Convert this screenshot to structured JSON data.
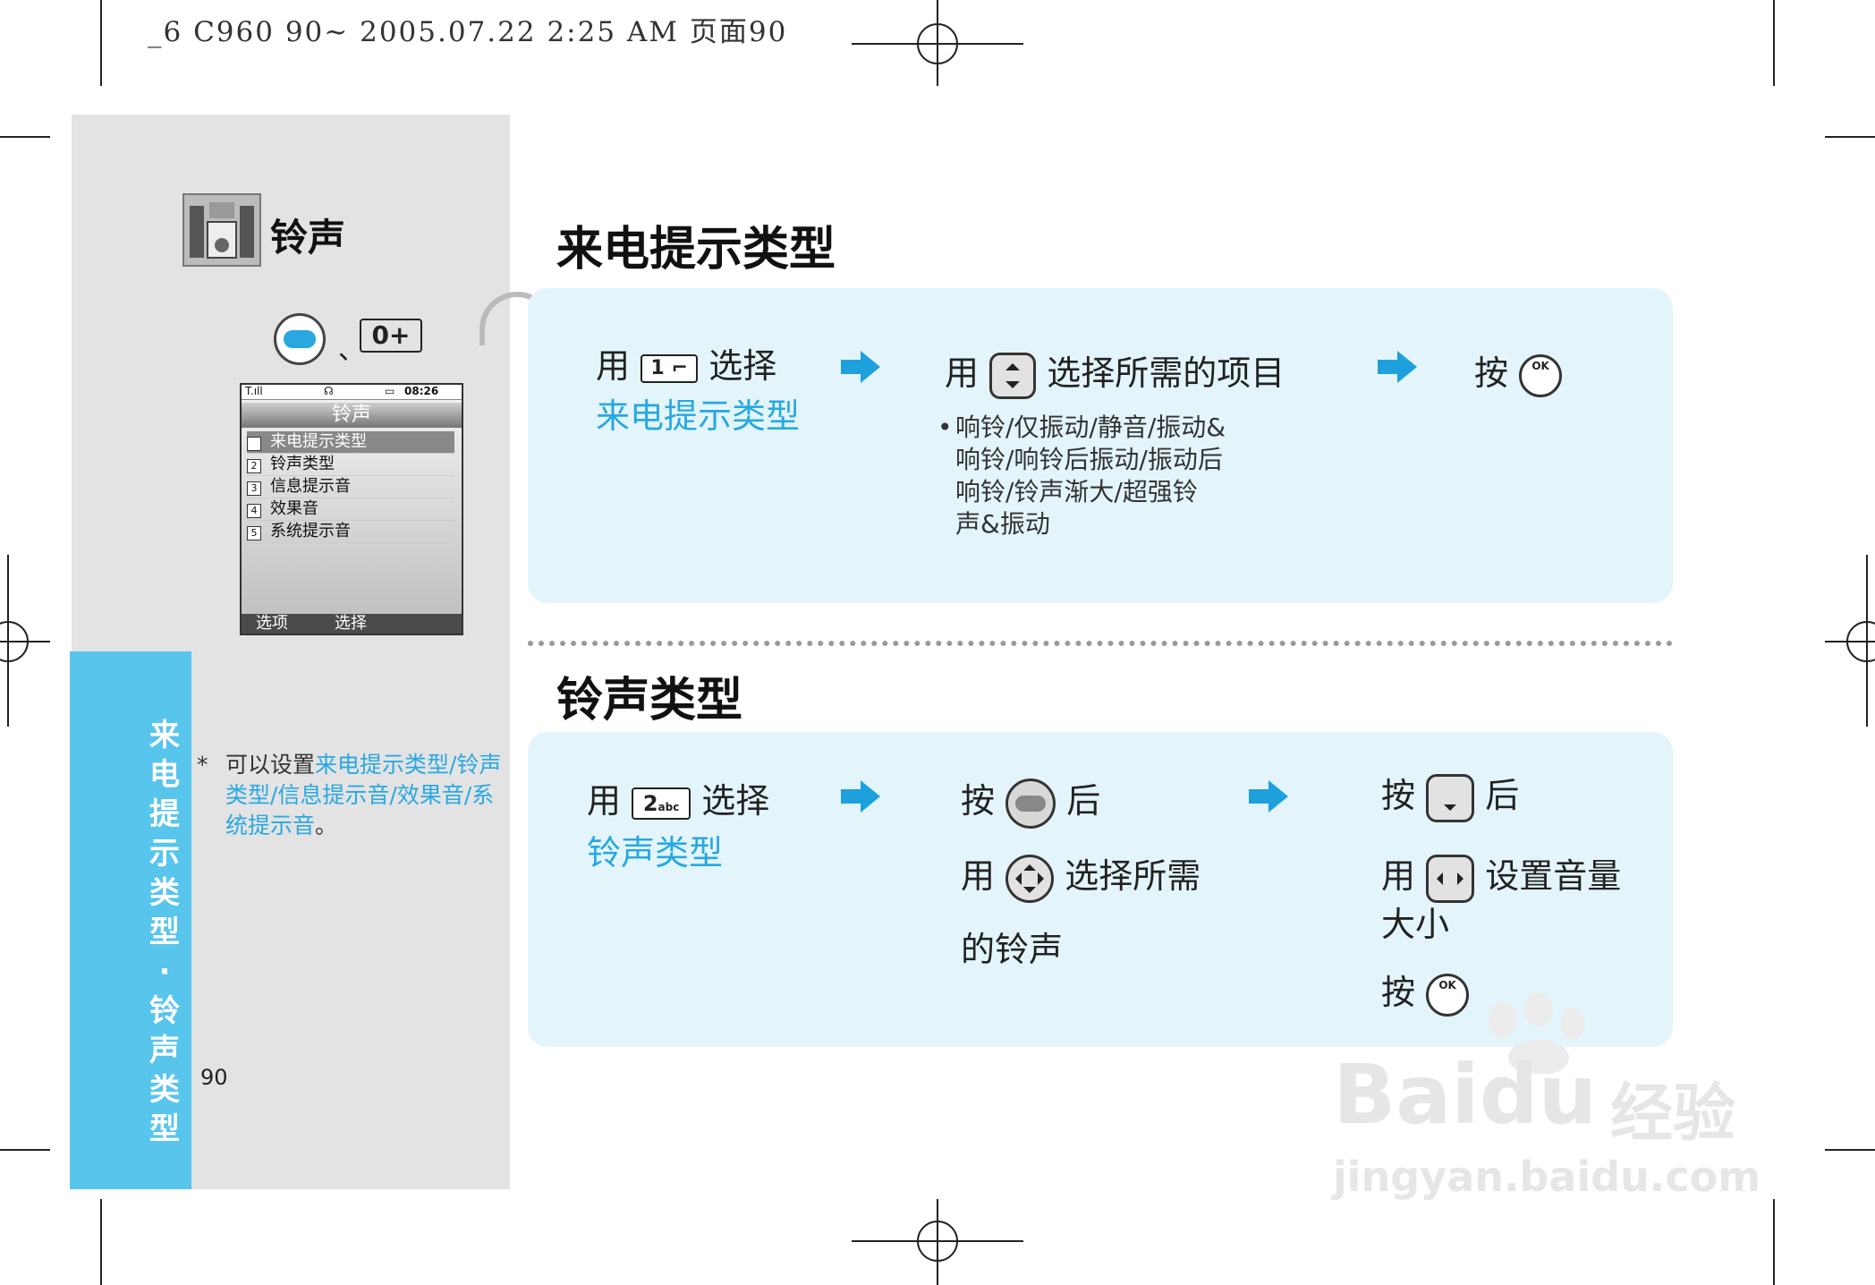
{
  "print_header": "_6 C960 90~ 2005.07.22 2:25 AM 页面90",
  "category": {
    "title": "铃声",
    "icon": "speaker-system-icon"
  },
  "access_keys": {
    "separator": "、",
    "key_0_label": "0+"
  },
  "phone_screen": {
    "title": "铃声",
    "status_time": "08:26",
    "items": [
      {
        "num": "1",
        "label": "来电提示类型"
      },
      {
        "num": "2",
        "label": "铃声类型"
      },
      {
        "num": "3",
        "label": "信息提示音"
      },
      {
        "num": "4",
        "label": "效果音"
      },
      {
        "num": "5",
        "label": "系统提示音"
      }
    ],
    "soft_left": "选项",
    "soft_right": "选择"
  },
  "side_tab": {
    "text": "来电提示类型·铃声类型"
  },
  "note": {
    "star": "*",
    "prefix": "可以设置",
    "highlight": "来电提示类型/铃声类型/信息提示音/效果音/系统提示音",
    "suffix": "。"
  },
  "page_number": "90",
  "section1": {
    "title": "来电提示类型",
    "step1": {
      "use": "用",
      "key": "1",
      "select": "选择",
      "target": "来电提示类型"
    },
    "step2": {
      "use": "用",
      "action": "选择所需的项目",
      "bullet": "•",
      "options_lines": [
        "响铃/仅振动/静音/振动&",
        "响铃/响铃后振动/振动后",
        "响铃/铃声渐大/超强铃",
        "声&振动"
      ]
    },
    "step3": {
      "press": "按",
      "ok_label": "OK"
    }
  },
  "section2": {
    "title": "铃声类型",
    "step1": {
      "use": "用",
      "key": "2",
      "key_sub": "abc",
      "select": "选择",
      "target": "铃声类型"
    },
    "step2": {
      "press": "按",
      "after": "后",
      "use": "用",
      "action1": "选择所需",
      "action2": "的铃声"
    },
    "step3": {
      "press": "按",
      "after": "后",
      "use": "用",
      "action1": "设置音量",
      "action2": "大小",
      "press2": "按",
      "ok_label": "OK"
    }
  },
  "watermark": {
    "brand": "Baidu",
    "suffix": "经验",
    "url": "jingyan.baidu.com"
  },
  "colors": {
    "accent": "#29a8e0",
    "panel": "#e3f5fb",
    "side_tab": "#58c5ed",
    "left_col": "#e3e3e4"
  }
}
